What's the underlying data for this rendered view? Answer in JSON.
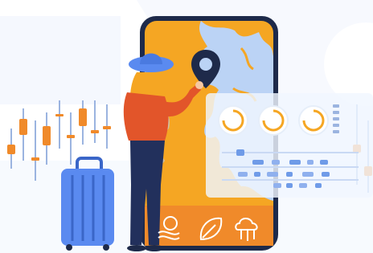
{
  "scene": {
    "description_text": "",
    "colors": {
      "accent_orange": "#F39C12",
      "deep_navy": "#1E2A4A",
      "sky_blue": "#BBD3F5",
      "suitcase_blue": "#5A8AF0",
      "light_bg": "#EAF2FD"
    },
    "phone": {
      "bottom_icons": [
        "sun-waves-icon",
        "leaf-icon",
        "cloud-network-icon"
      ]
    },
    "card": {
      "gauges": [
        {
          "name": "gauge-1",
          "level": 0.75
        },
        {
          "name": "gauge-2",
          "level": 0.75
        },
        {
          "name": "gauge-3",
          "level": 0.75
        }
      ]
    }
  }
}
